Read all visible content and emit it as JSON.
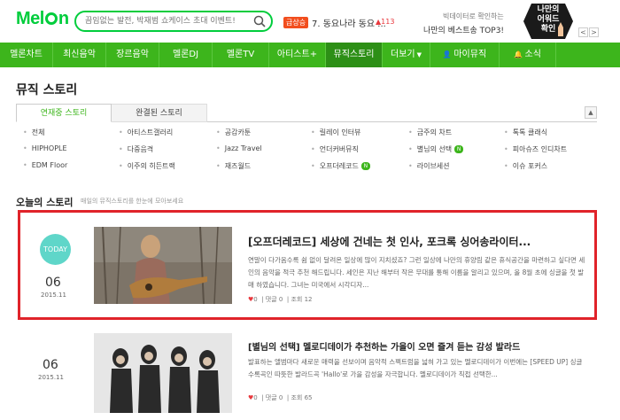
{
  "header": {
    "logo": "Melon",
    "search_placeholder": "끔임없는 발전, 박재범 쇼케이스 초대 이벤트!",
    "rank_badge": "급상승",
    "rank_text": "7. 동요나라 동요 ...",
    "rank_change": "▲113",
    "promo_sub": "빅데이터로 확인하는",
    "promo_main": "나만의 베스트송 TOP3!",
    "promo_hex": "나만의\n어워드\n확인",
    "prev": "<",
    "next": ">"
  },
  "gnb": [
    {
      "label": "멜론차트",
      "width": 60
    },
    {
      "label": "최신음악",
      "width": 60
    },
    {
      "label": "장르음악",
      "width": 60
    },
    {
      "label": "멜론DJ",
      "width": 60
    },
    {
      "label": "멜론TV",
      "width": 64
    },
    {
      "label": "아티스트+",
      "width": 64
    },
    {
      "label": "뮤직스토리",
      "width": 64,
      "active": true
    },
    {
      "label": "더보기",
      "width": 54,
      "dropdown": true
    },
    {
      "label": "마이뮤직",
      "width": 78,
      "icon": "person-icon"
    },
    {
      "label": "소식",
      "width": 64,
      "icon": "bell-icon"
    }
  ],
  "page_title": "뮤직 스토리",
  "tabs": {
    "active": "연재중 스토리",
    "inactive": "완결된 스토리",
    "collapse": "▲"
  },
  "categories": [
    [
      "전체",
      "아티스트갤러리",
      "공감카툰",
      "릴레이 인터뷰",
      "금주의 차트",
      "톡톡 클래식"
    ],
    [
      "HIPHOPLE",
      "다중음격",
      "Jazz Travel",
      "언더커버뮤직",
      "별님의 선택",
      "피아슈즈 인디차트"
    ],
    [
      "EDM Floor",
      "이주의 히든트랙",
      "재즈월드",
      "오프더레코드",
      "라이브세션",
      "이슈 포커스"
    ]
  ],
  "category_new_badge": "N",
  "section": {
    "title": "오늘의 스토리",
    "subtitle": "매일의 뮤직스토리를 한눈에 모아보세요"
  },
  "stories": [
    {
      "today_label": "TODAY",
      "day": "06",
      "date": "2015.11",
      "title": "[오프더레코드] 세상에 건네는 첫 인사, 포크록 싱어송라이터...",
      "desc": "연말이 다가옴수록 쉼 없이 달려온 일상에 많이 지치셨죠? 그런 일상에 나만의 휴양림 같은 휴식공간을 마련하고 싶다면 세인의 음악을 적극 추천 해드립니다. 세인은 지난 해부터 작은 무대를 통해 이름을 알리고 있으며, 올 8월 초에 싱글을 첫 발매 하였습니다. 그녀는 미국에서 시각디자...",
      "likes": "0",
      "comments_label": "댓글",
      "comments": "0",
      "views_label": "조회",
      "views": "12"
    },
    {
      "day": "06",
      "date": "2015.11",
      "title": "[별님의 선택] 멜로디데이가 추천하는 가을이 오면 즐겨 듣는 감성 발라드",
      "desc": "발표하는 앨범마다 새로운 매력을 선보이며 음악적 스펙트럼을 넓혀 가고 있는 멜로디데이가 이번에는 [SPEED UP] 싱글 수록곡인 따뜻한 발라드곡 'Hallo'로 가을 감성을 자극합니다. 멜로디데이가 직접 선택한...",
      "likes": "0",
      "comments_label": "댓글",
      "comments": "0",
      "views_label": "조회",
      "views": "65"
    }
  ],
  "colors": {
    "brand": "#3db51c",
    "highlight_border": "#e0232a",
    "today_circle": "#5fd6c9"
  }
}
